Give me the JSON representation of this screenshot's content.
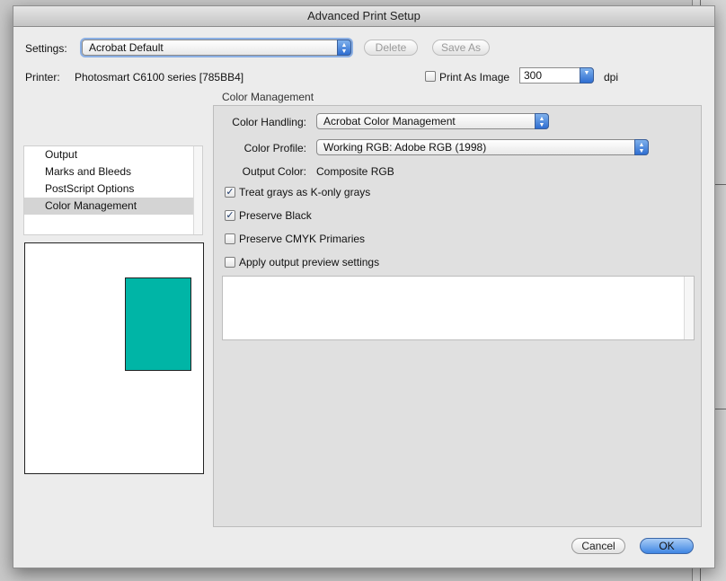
{
  "window": {
    "title": "Advanced Print Setup"
  },
  "settings": {
    "label": "Settings:",
    "value": "Acrobat Default",
    "delete_label": "Delete",
    "save_as_label": "Save As"
  },
  "printer": {
    "label": "Printer:",
    "name": "Photosmart C6100 series [785BB4]",
    "print_as_image_label": "Print As Image",
    "print_as_image_checked": false,
    "dpi_value": "300",
    "dpi_unit": "dpi"
  },
  "sidebar": {
    "items": [
      {
        "label": "Output",
        "selected": false
      },
      {
        "label": "Marks and Bleeds",
        "selected": false
      },
      {
        "label": "PostScript Options",
        "selected": false
      },
      {
        "label": "Color Management",
        "selected": true
      }
    ]
  },
  "preview": {
    "page_color": "#00b5a6"
  },
  "color_management": {
    "heading": "Color Management",
    "color_handling_label": "Color Handling:",
    "color_handling_value": "Acrobat Color Management",
    "color_profile_label": "Color Profile:",
    "color_profile_value": "Working RGB: Adobe RGB (1998)",
    "output_color_label": "Output Color:",
    "output_color_value": "Composite RGB",
    "options": [
      {
        "label": "Treat grays as K-only grays",
        "checked": true
      },
      {
        "label": "Preserve Black",
        "checked": true
      },
      {
        "label": "Preserve CMYK Primaries",
        "checked": false
      },
      {
        "label": "Apply output preview settings",
        "checked": false
      }
    ]
  },
  "footer": {
    "cancel_label": "Cancel",
    "ok_label": "OK"
  },
  "colors": {
    "accent": "#3f86e3",
    "dialog_bg": "#ececec",
    "panel_bg": "#e0e0e0"
  }
}
